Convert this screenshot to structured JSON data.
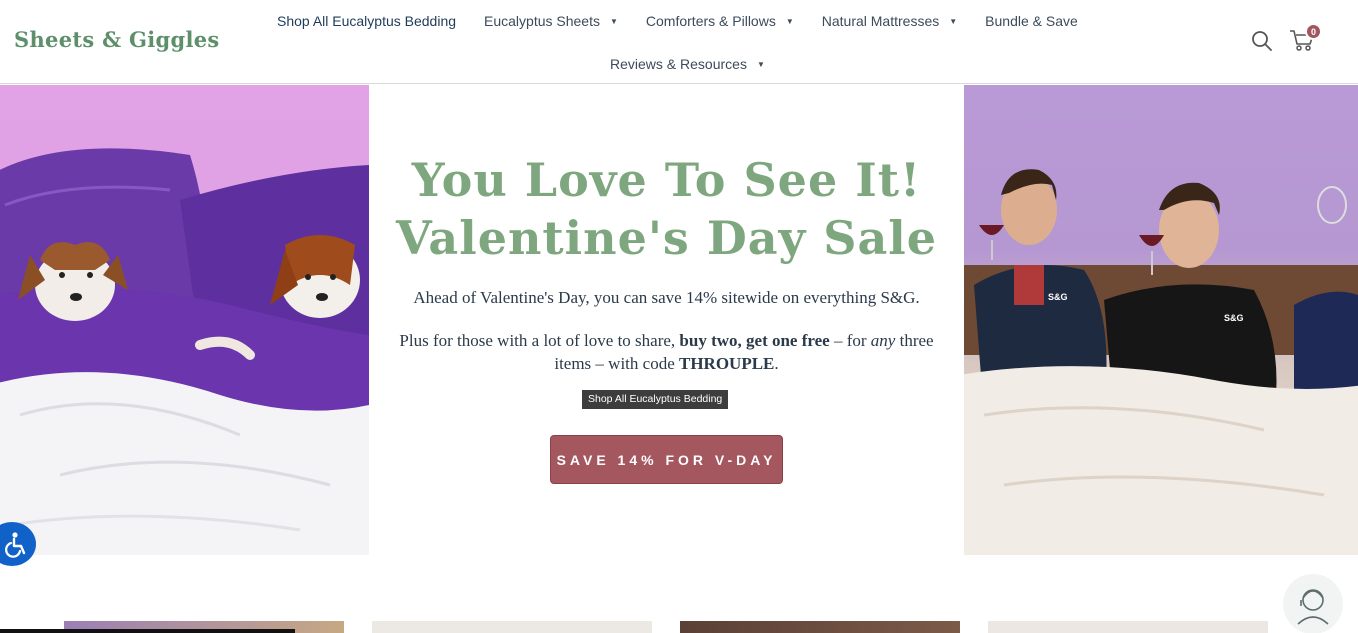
{
  "brand": {
    "logo": "Sheets & Giggles"
  },
  "nav": {
    "row1": [
      {
        "label": "Shop All Eucalyptus Bedding",
        "has_dropdown": false,
        "active": true
      },
      {
        "label": "Eucalyptus Sheets",
        "has_dropdown": true
      },
      {
        "label": "Comforters & Pillows",
        "has_dropdown": true
      },
      {
        "label": "Natural Mattresses",
        "has_dropdown": true
      },
      {
        "label": "Bundle & Save",
        "has_dropdown": false
      }
    ],
    "row2": [
      {
        "label": "Reviews & Resources",
        "has_dropdown": true
      }
    ],
    "cart_count": "0",
    "icons": [
      "search-icon",
      "cart-icon"
    ]
  },
  "hero": {
    "headline_line1": "You Love To See It!",
    "headline_line2": "Valentine's Day Sale",
    "para1": "Ahead of Valentine's Day, you can save 14% sitewide on everything S&G.",
    "para2_part1": "Plus for those with a lot of love to share, ",
    "para2_bold": "buy two, get one free",
    "para2_part2": " – for ",
    "para2_italic": "any",
    "para2_part3": " three items – with code ",
    "para2_code": "THROUPLE",
    "para2_end": ".",
    "tooltip": "Shop All Eucalyptus Bedding",
    "cta_label": "SAVE 14% FOR V-DAY",
    "right_image_robe_text_1": "S&G",
    "right_image_robe_text_2": "S&G"
  },
  "colors": {
    "headline": "#7fa77f",
    "cta": "#a4575f",
    "cart_badge": "#a3565e",
    "accessibility": "#1162c8"
  }
}
